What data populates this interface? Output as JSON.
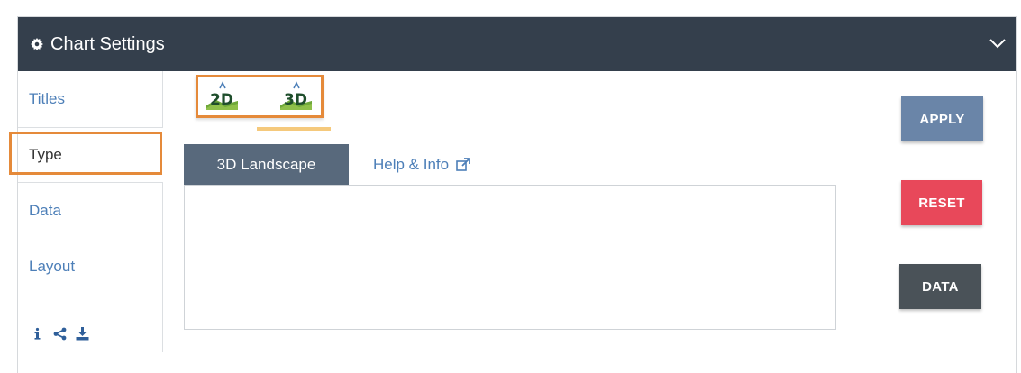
{
  "header": {
    "title": "Chart Settings",
    "gear_icon": "gear-icon",
    "collapse_icon": "chevron-down-icon"
  },
  "sidebar": {
    "items": [
      {
        "label": "Titles"
      },
      {
        "label": "Type",
        "selected": true
      },
      {
        "label": "Data"
      },
      {
        "label": "Layout"
      }
    ],
    "icons": [
      "info-icon",
      "share-icon",
      "download-icon"
    ]
  },
  "type_selector": {
    "options": [
      {
        "label": "2D",
        "icon": "chart-2d-icon"
      },
      {
        "label": "3D",
        "icon": "chart-3d-icon",
        "active": true
      }
    ]
  },
  "tabs": {
    "active_label": "3D Landscape",
    "help_label": "Help & Info",
    "help_icon": "external-link-icon"
  },
  "buttons": {
    "apply": "APPLY",
    "reset": "RESET",
    "data": "DATA"
  },
  "colors": {
    "header_bg": "#343f4c",
    "link": "#4d7fb8",
    "highlight": "#e58a3a",
    "apply": "#6a85a8",
    "reset": "#e8485a",
    "data": "#4a5258",
    "tab_active": "#58697c"
  }
}
